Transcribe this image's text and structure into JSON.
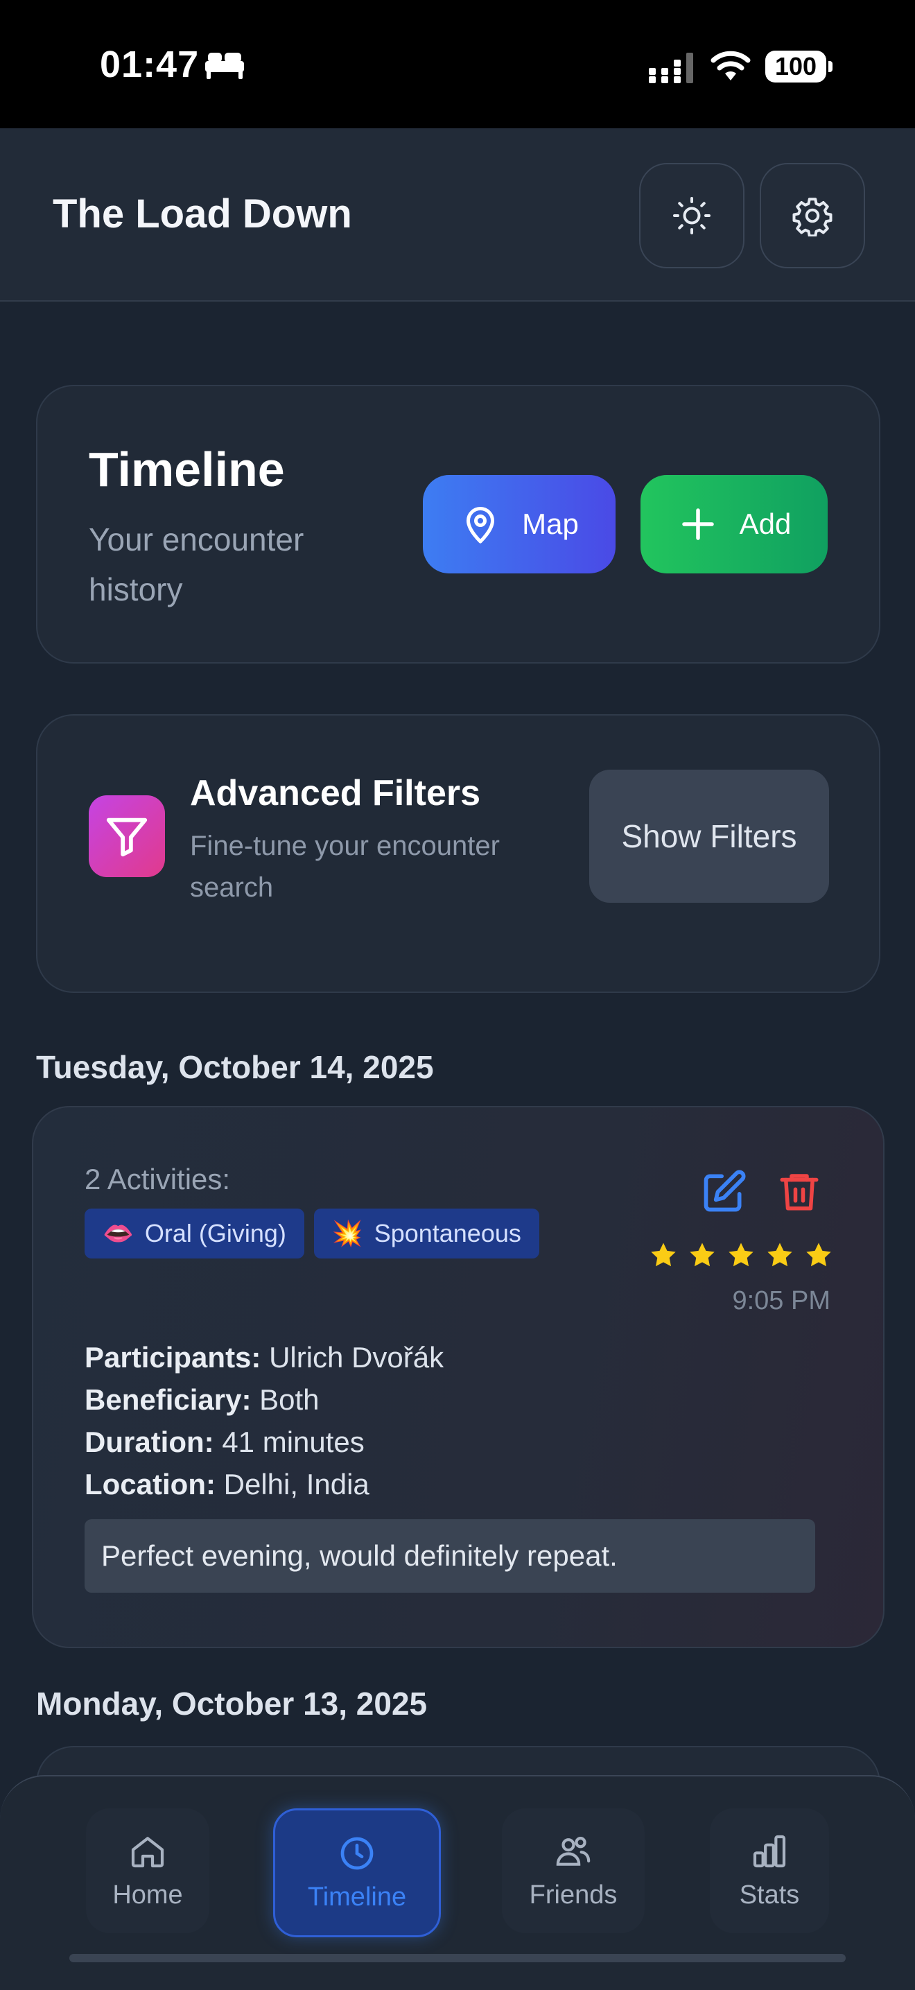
{
  "status_bar": {
    "time": "01:47",
    "battery": "100"
  },
  "header": {
    "title": "The Load Down"
  },
  "timeline_card": {
    "title": "Timeline",
    "subtitle": "Your encounter history",
    "map_label": "Map",
    "add_label": "Add"
  },
  "filters_card": {
    "title": "Advanced Filters",
    "subtitle": "Fine-tune your encounter search",
    "button_label": "Show Filters"
  },
  "days": [
    {
      "date": "Tuesday, October 14, 2025",
      "entry": {
        "activities_label": "2 Activities:",
        "tags": [
          {
            "emoji": "👄",
            "label": "Oral (Giving)"
          },
          {
            "emoji": "💥",
            "label": "Spontaneous"
          }
        ],
        "rating": 5,
        "time": "9:05 PM",
        "details": [
          {
            "label": "Participants:",
            "value": "Ulrich Dvořák"
          },
          {
            "label": "Beneficiary:",
            "value": "Both"
          },
          {
            "label": "Duration:",
            "value": "41 minutes"
          },
          {
            "label": "Location:",
            "value": "Delhi, India"
          }
        ],
        "notes": "Perfect evening, would definitely repeat."
      }
    },
    {
      "date": "Monday, October 13, 2025"
    }
  ],
  "tabs": [
    {
      "label": "Home",
      "icon": "home-icon",
      "active": false
    },
    {
      "label": "Timeline",
      "icon": "clock-icon",
      "active": true
    },
    {
      "label": "Friends",
      "icon": "friends-icon",
      "active": false
    },
    {
      "label": "Stats",
      "icon": "bar-chart-icon",
      "active": false
    }
  ],
  "colors": {
    "background": "#1b2431",
    "accent_blue": "#3b82f6",
    "accent_green": "#22c55e",
    "danger_red": "#ef4444",
    "star_yellow": "#facc15"
  }
}
